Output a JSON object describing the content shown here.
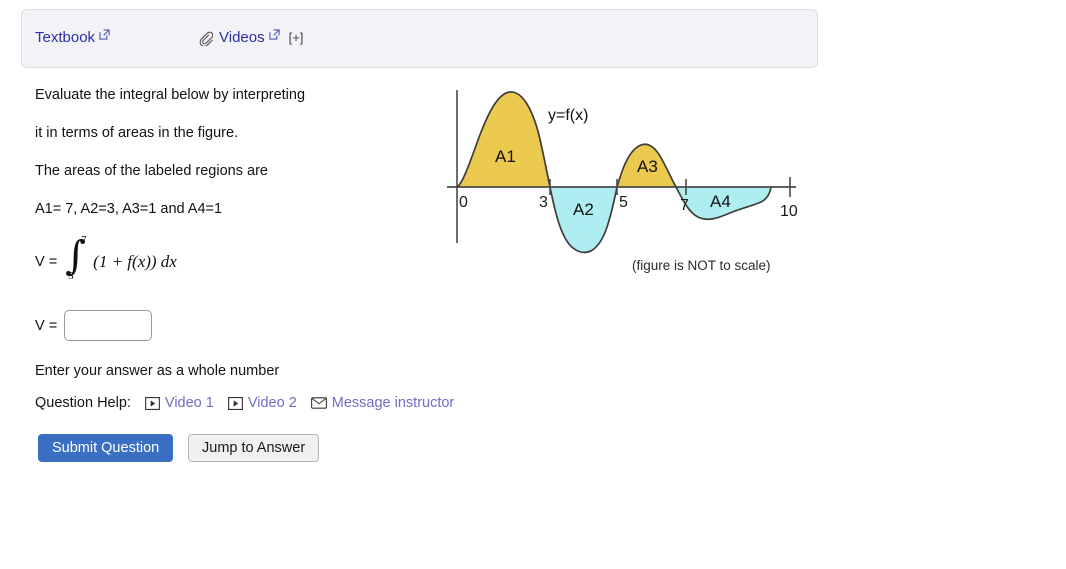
{
  "resources": {
    "textbook_label": "Textbook",
    "videos_label": "Videos",
    "plus_label": "[+]",
    "external_icon": "external-link-icon",
    "paperclip_icon": "paperclip-icon"
  },
  "question": {
    "line1": "Evaluate the integral below by interpreting",
    "line2": "it in terms of areas in the figure.",
    "line3": "The areas of the labeled regions are",
    "line4": "A1= 7, A2=3, A3=1 and A4=1",
    "integral": {
      "lhs": "V =",
      "symbol": "∫",
      "upper_limit": "7",
      "lower_limit": "3",
      "integrand": "(1 + f(x)) dx"
    }
  },
  "answer": {
    "label": "V =",
    "value": "",
    "placeholder": "",
    "hint": "Enter your answer as a whole number"
  },
  "help": {
    "label": "Question Help:",
    "links": [
      {
        "label": "Video 1",
        "icon": "video-icon"
      },
      {
        "label": "Video 2",
        "icon": "video-icon"
      },
      {
        "label": "Message instructor",
        "icon": "mail-icon"
      }
    ]
  },
  "buttons": {
    "submit": "Submit Question",
    "jump": "Jump to Answer",
    "submit_color": "#3a6fc4"
  },
  "figure": {
    "curve_label": "y=f(x)",
    "caption": "(figure is NOT to scale)",
    "region_labels": [
      "A1",
      "A2",
      "A3",
      "A4"
    ],
    "tick_labels": [
      "0",
      "3",
      "5",
      "7",
      "10"
    ],
    "positive_fill": "#ebc84e",
    "negative_fill": "#aeeef1",
    "curve_stroke": "#3d3d3d",
    "axis_stroke": "#4a4a4a"
  },
  "chart_data": {
    "type": "area",
    "title": "y=f(x)",
    "xlabel": "",
    "ylabel": "",
    "xlim": [
      0,
      10
    ],
    "grid": false,
    "legend": "none",
    "annotations": [
      "y=f(x)",
      "(figure is NOT to scale)"
    ],
    "x_ticks": [
      0,
      3,
      5,
      7,
      10
    ],
    "x_tick_labels": [
      "0",
      "3",
      "5",
      "7",
      "10"
    ],
    "regions": [
      {
        "label": "A1",
        "x_start": 0,
        "x_end": 3,
        "sign": "positive",
        "area": 7,
        "fill": "#ebc84e"
      },
      {
        "label": "A2",
        "x_start": 3,
        "x_end": 5,
        "sign": "negative",
        "area": 3,
        "fill": "#aeeef1"
      },
      {
        "label": "A3",
        "x_start": 5,
        "x_end": 7,
        "sign": "positive",
        "area": 1,
        "fill": "#ebc84e"
      },
      {
        "label": "A4",
        "x_start": 7,
        "x_end": 10,
        "sign": "negative",
        "area": 1,
        "fill": "#aeeef1"
      }
    ]
  }
}
